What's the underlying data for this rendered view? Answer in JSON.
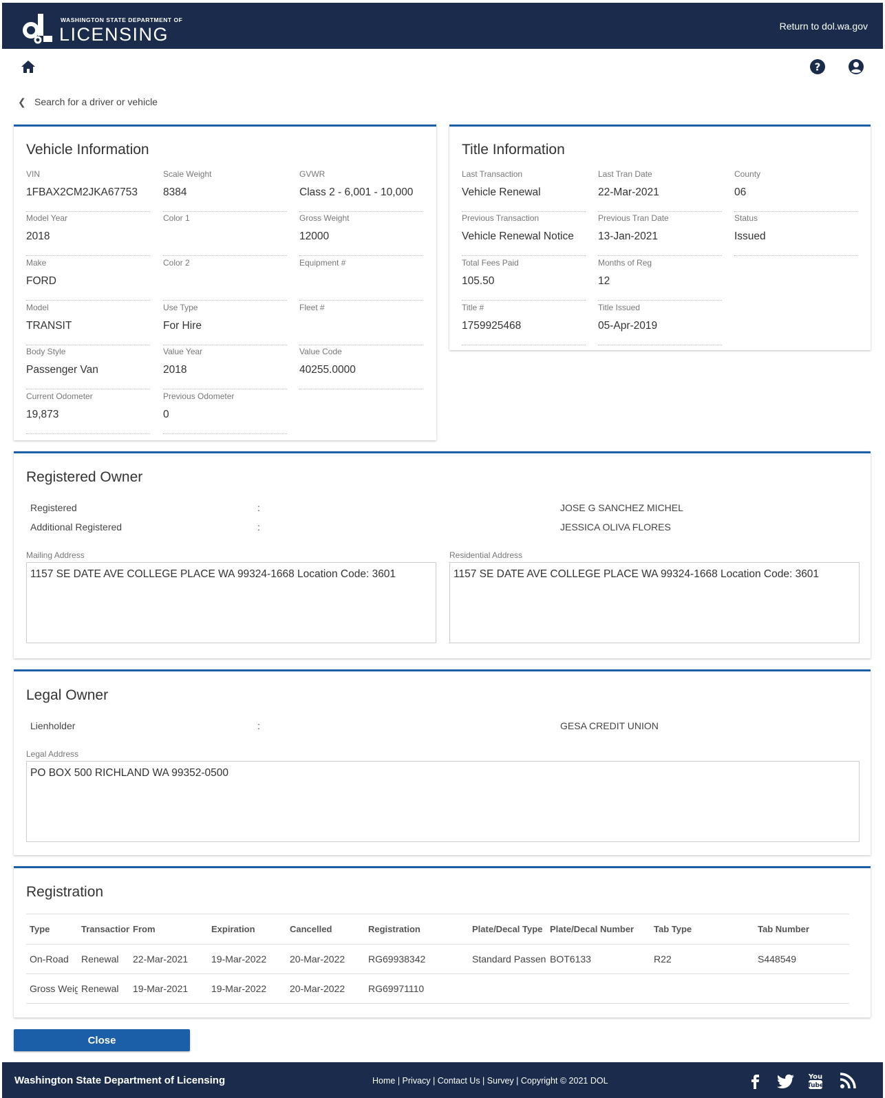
{
  "header": {
    "logo_small": "WASHINGTON STATE DEPARTMENT OF",
    "logo_big": "LICENSING",
    "return_link": "Return to dol.wa.gov"
  },
  "breadcrumb": {
    "label": "Search for a driver or vehicle"
  },
  "vehicle": {
    "title": "Vehicle Information",
    "fields": [
      {
        "label": "VIN",
        "value": "1FBAX2CM2JKA67753"
      },
      {
        "label": "Scale Weight",
        "value": "8384"
      },
      {
        "label": "GVWR",
        "value": "Class 2 - 6,001 - 10,000"
      },
      {
        "label": "Model Year",
        "value": "2018"
      },
      {
        "label": "Color 1",
        "value": ""
      },
      {
        "label": "Gross Weight",
        "value": "12000"
      },
      {
        "label": "Make",
        "value": "FORD"
      },
      {
        "label": "Color 2",
        "value": ""
      },
      {
        "label": "Equipment #",
        "value": ""
      },
      {
        "label": "Model",
        "value": "TRANSIT"
      },
      {
        "label": "Use Type",
        "value": "For Hire"
      },
      {
        "label": "Fleet #",
        "value": ""
      },
      {
        "label": "Body Style",
        "value": "Passenger Van"
      },
      {
        "label": "Value Year",
        "value": "2018"
      },
      {
        "label": "Value Code",
        "value": "40255.0000"
      },
      {
        "label": "Current Odometer",
        "value": "19,873"
      },
      {
        "label": "Previous Odometer",
        "value": "0"
      }
    ]
  },
  "title_info": {
    "title": "Title Information",
    "fields": [
      {
        "label": "Last Transaction",
        "value": "Vehicle Renewal"
      },
      {
        "label": "Last Tran Date",
        "value": "22-Mar-2021"
      },
      {
        "label": "County",
        "value": "06"
      },
      {
        "label": "Previous Transaction",
        "value": "Vehicle Renewal Notice"
      },
      {
        "label": "Previous Tran Date",
        "value": "13-Jan-2021"
      },
      {
        "label": "Status",
        "value": "Issued"
      },
      {
        "label": "Total Fees Paid",
        "value": "105.50"
      },
      {
        "label": "Months of Reg",
        "value": "12"
      },
      {
        "label": "Title #",
        "value": "1759925468"
      },
      {
        "label": "Title Issued",
        "value": "05-Apr-2019"
      }
    ]
  },
  "registered_owner": {
    "title": "Registered Owner",
    "rows": [
      {
        "label": "Registered",
        "colon": ":",
        "value": "JOSE G SANCHEZ MICHEL"
      },
      {
        "label": "Additional Registered",
        "colon": ":",
        "value": "JESSICA OLIVA FLORES"
      }
    ],
    "mailing_label": "Mailing Address",
    "mailing_address": "1157 SE DATE AVE COLLEGE PLACE WA 99324-1668   Location Code: 3601",
    "residential_label": "Residential Address",
    "residential_address": "1157 SE DATE AVE COLLEGE PLACE WA 99324-1668   Location Code: 3601"
  },
  "legal_owner": {
    "title": "Legal Owner",
    "row": {
      "label": "Lienholder",
      "colon": ":",
      "value": "GESA CREDIT UNION"
    },
    "address_label": "Legal Address",
    "address": "PO BOX 500 RICHLAND WA 99352-0500"
  },
  "registration": {
    "title": "Registration",
    "columns": [
      "Type",
      "Transaction",
      "From",
      "Expiration",
      "Cancelled",
      "Registration",
      "Plate/Decal Type",
      "Plate/Decal Number",
      "Tab Type",
      "Tab Number"
    ],
    "rows": [
      [
        "On-Road",
        "Renewal",
        "22-Mar-2021",
        "19-Mar-2022",
        "20-Mar-2022",
        "RG69938342",
        "Standard Passenger",
        "BOT6133",
        "R22",
        "S448549"
      ],
      [
        "Gross Weight",
        "Renewal",
        "19-Mar-2021",
        "19-Mar-2022",
        "20-Mar-2022",
        "RG69971110",
        "",
        "",
        "",
        ""
      ]
    ]
  },
  "close_button": "Close",
  "footer": {
    "name": "Washington State Department of Licensing",
    "links": [
      "Home",
      "Privacy",
      "Contact Us",
      "Survey",
      "Copyright © 2021 DOL"
    ],
    "sep": " | "
  },
  "icons": {
    "home": "home-icon",
    "help": "help-icon",
    "user": "user-icon",
    "back": "chevron-left-icon",
    "facebook": "facebook-icon",
    "twitter": "twitter-icon",
    "youtube": "youtube-icon",
    "rss": "rss-icon"
  },
  "colors": {
    "header_bg": "#1a2b4c",
    "accent": "#1a5fa8"
  }
}
